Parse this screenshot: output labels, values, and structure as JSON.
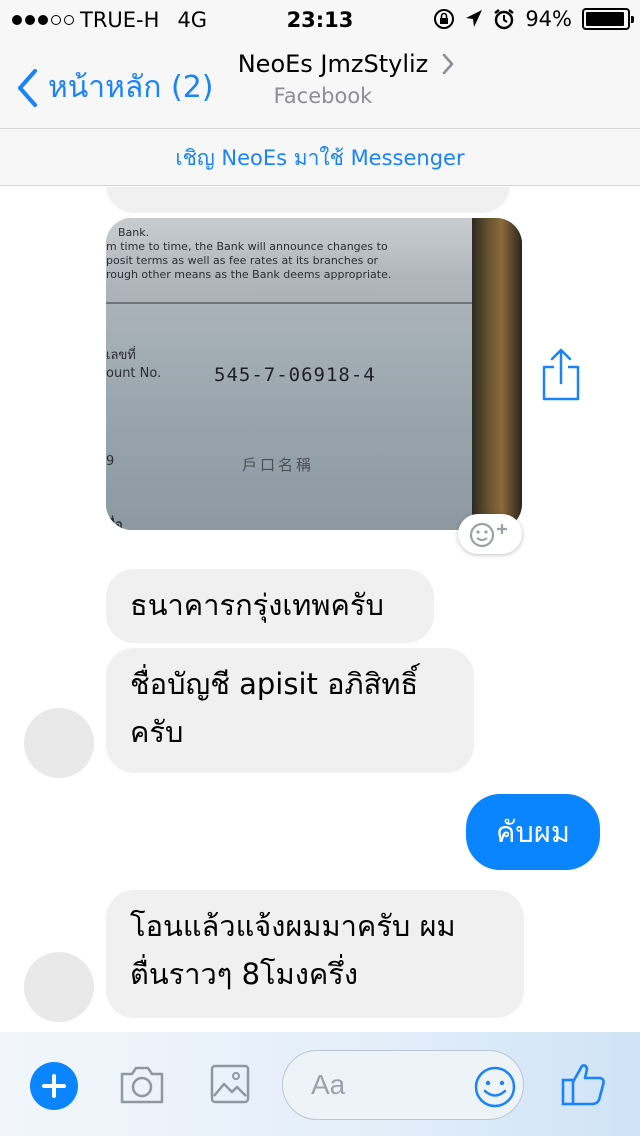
{
  "status_bar": {
    "signal_dots_filled": 3,
    "signal_dots_total": 5,
    "carrier": "TRUE-H",
    "network": "4G",
    "time": "23:13",
    "battery": "94%",
    "battery_level": 0.94,
    "icons": [
      "orientation-lock-icon",
      "location-arrow-icon",
      "alarm-icon"
    ]
  },
  "nav": {
    "back_label": "หน้าหลัก (2)",
    "contact_name": "NeoEs JmzStyliz",
    "contact_source": "Facebook"
  },
  "invite_bar": {
    "text": "เชิญ NeoEs มาใช้ Messenger"
  },
  "photo": {
    "fine_print": [
      "Bank.",
      "m time to time, the Bank will announce changes to",
      "posit terms as well as fee rates at its branches or",
      "rough other means as the Bank deems appropriate."
    ],
    "label_thai": "ีเลขที่",
    "label_en": "ount No.",
    "account_number": "545-7-06918-4",
    "label_side": "9",
    "kanji": "戶口名稱",
    "label_bottom": "ชื่อ"
  },
  "messages": {
    "m1": "ธนาคารกรุ่งเทพครับ",
    "m2_line1": "ชื่อบัญชี  apisit อภิสิทธิ์",
    "m2_line2": "ครับ",
    "m3": "คับผม",
    "m4_line1": "โอนแล้วแจ้งผมมาครับ  ผม",
    "m4_line2": "ตื่นราวๆ 8โมงครึ่ง"
  },
  "composer": {
    "placeholder": "Aa"
  },
  "colors": {
    "accent": "#0a84ff",
    "incoming_bubble": "#f0f0f0"
  }
}
